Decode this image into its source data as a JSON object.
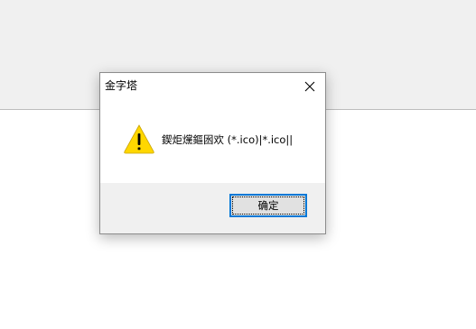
{
  "dialog": {
    "title": "金字塔",
    "message": "鍥炬爣鏂囦欢 (*.ico)|*.ico||",
    "ok_label": "确定",
    "icon": "warning-triangle-icon",
    "close_icon": "close-icon"
  },
  "colors": {
    "backdrop_top": "#f0f0f0",
    "backdrop_bottom": "#ffffff",
    "dialog_footer": "#f0f0f0",
    "button_focus_border": "#0078d7",
    "button_face": "#e1e1e1",
    "warning_yellow": "#ffd700"
  }
}
